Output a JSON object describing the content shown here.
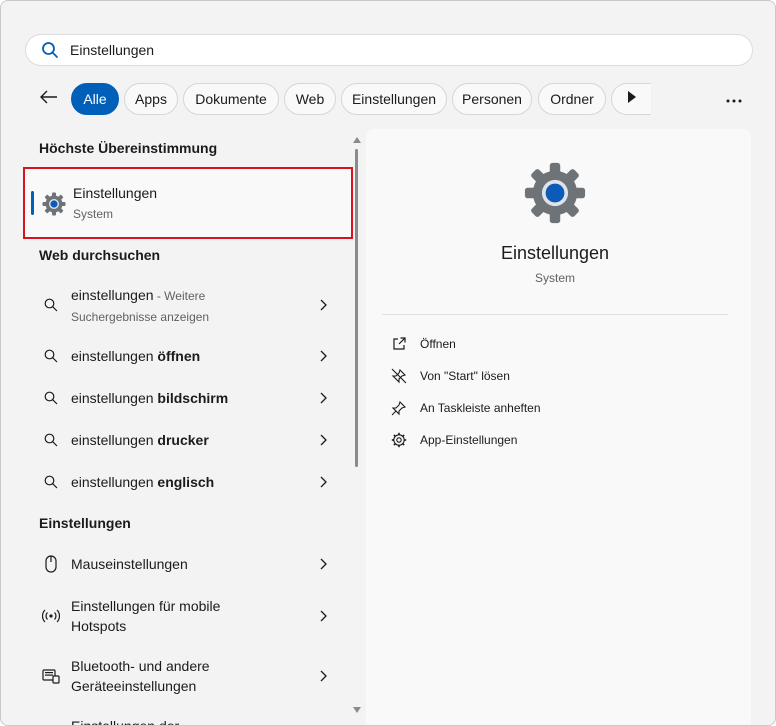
{
  "search": {
    "value": "Einstellungen",
    "icon": "search-icon"
  },
  "filters": {
    "back_icon": "arrow-left-icon",
    "chips": [
      {
        "label": "Alle",
        "active": true
      },
      {
        "label": "Apps"
      },
      {
        "label": "Dokumente"
      },
      {
        "label": "Web"
      },
      {
        "label": "Einstellungen"
      },
      {
        "label": "Personen"
      },
      {
        "label": "Ordner"
      }
    ],
    "play_icon": "play-icon",
    "more_icon": "more-icon"
  },
  "left": {
    "best_match_heading": "Höchste Übereinstimmung",
    "best_match": {
      "title": "Einstellungen",
      "subtitle": "System",
      "icon": "gear-icon"
    },
    "web_heading": "Web durchsuchen",
    "web_results": [
      {
        "plain": "einstellungen",
        "bold": "",
        "suffix": " - Weitere",
        "suffix2": "Suchergebnisse anzeigen"
      },
      {
        "plain": "einstellungen ",
        "bold": "öffnen"
      },
      {
        "plain": "einstellungen ",
        "bold": "bildschirm"
      },
      {
        "plain": "einstellungen ",
        "bold": "drucker"
      },
      {
        "plain": "einstellungen ",
        "bold": "englisch"
      }
    ],
    "settings_heading": "Einstellungen",
    "settings_results": [
      {
        "line1": "Mauseinstellungen",
        "icon": "mouse-icon"
      },
      {
        "line1": "Einstellungen für mobile",
        "line2": "Hotspots",
        "icon": "hotspot-icon"
      },
      {
        "line1": "Bluetooth- und andere",
        "line2": "Geräteeinstellungen",
        "icon": "devices-icon"
      },
      {
        "line1": "Einstellungen der"
      }
    ]
  },
  "right": {
    "title": "Einstellungen",
    "subtitle": "System",
    "actions": [
      {
        "label": "Öffnen",
        "icon": "open-external-icon"
      },
      {
        "label": "Von \"Start\" lösen",
        "icon": "unpin-icon"
      },
      {
        "label": "An Taskleiste anheften",
        "icon": "pin-icon"
      },
      {
        "label": "App-Einstellungen",
        "icon": "gear-icon"
      }
    ]
  },
  "colors": {
    "accent": "#005fb8",
    "highlight_border": "#d7131d"
  }
}
